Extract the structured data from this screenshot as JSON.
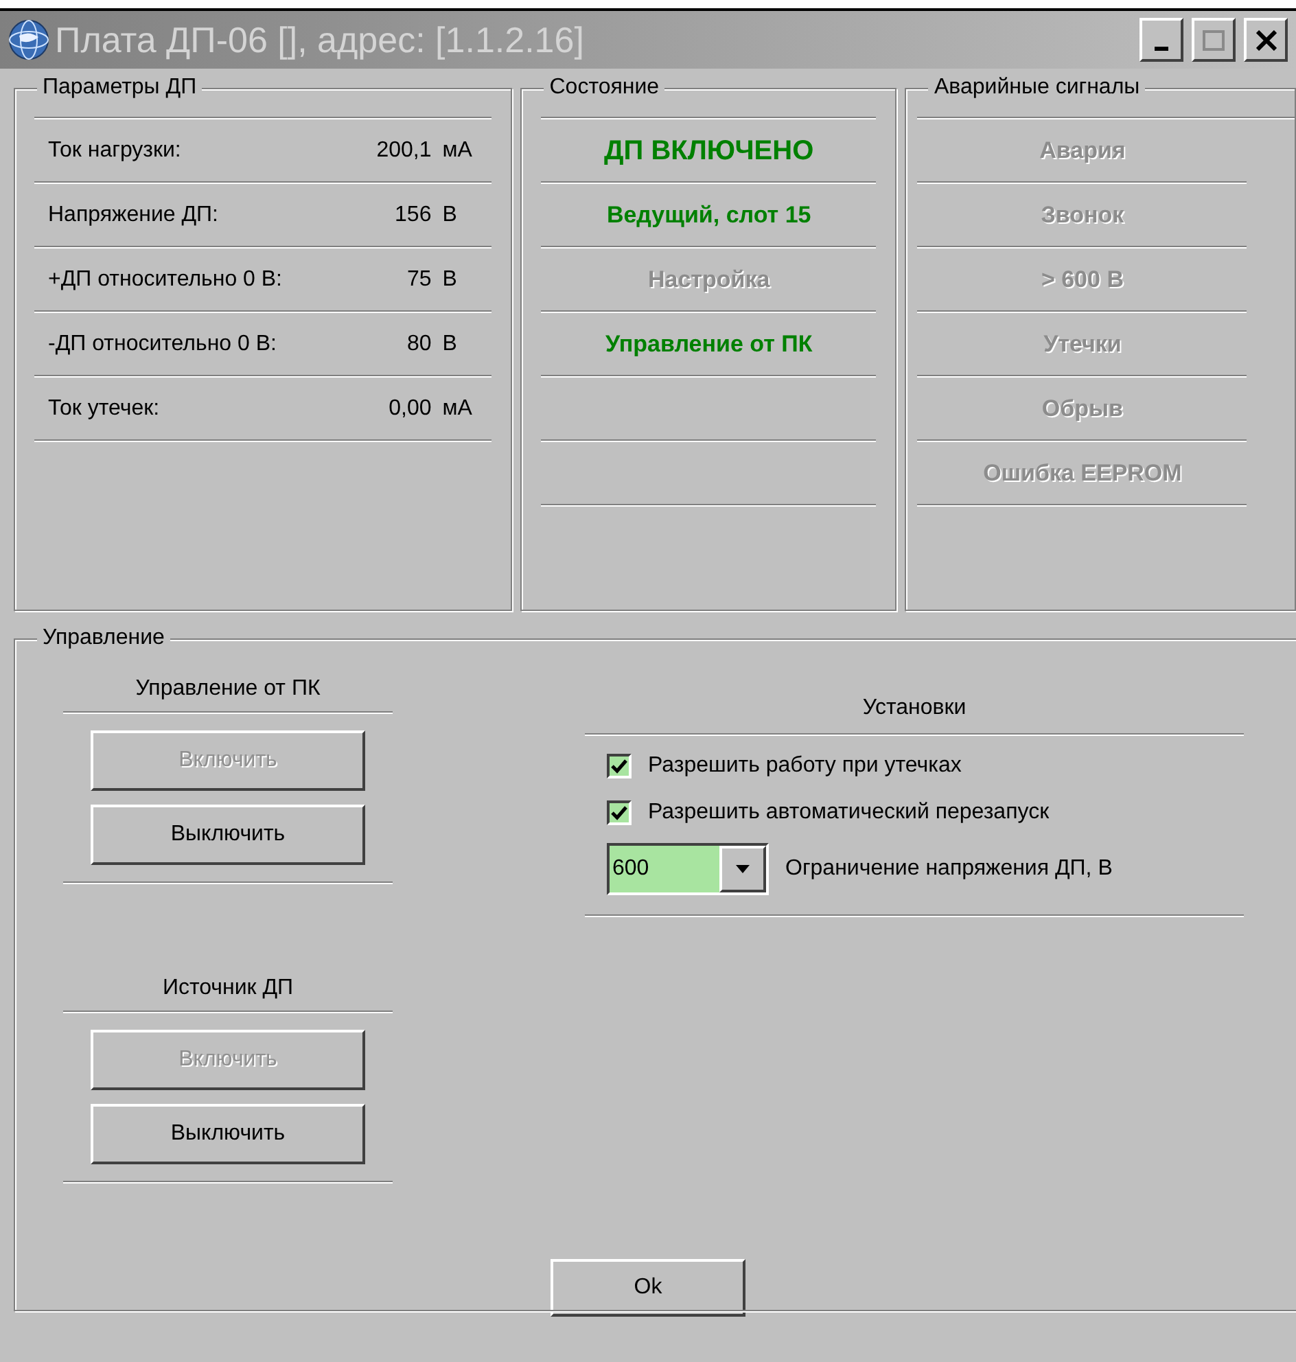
{
  "window": {
    "title": "Плата ДП-06 [], адрес: [1.1.2.16]"
  },
  "parameters": {
    "title": "Параметры ДП",
    "rows": [
      {
        "label": "Ток нагрузки:",
        "value": "200,1",
        "unit": "мА"
      },
      {
        "label": "Напряжение ДП:",
        "value": "156",
        "unit": "В"
      },
      {
        "label": "+ДП относительно 0 В:",
        "value": "75",
        "unit": "В"
      },
      {
        "label": "-ДП относительно 0 В:",
        "value": "80",
        "unit": "В"
      },
      {
        "label": "Ток утечек:",
        "value": "0,00",
        "unit": "мА"
      }
    ]
  },
  "status": {
    "title": "Состояние",
    "items": [
      {
        "text": "ДП ВКЛЮЧЕНО",
        "active": true
      },
      {
        "text": "Ведущий, слот 15",
        "active": true
      },
      {
        "text": "Настройка",
        "active": false
      },
      {
        "text": "Управление от ПК",
        "active": true
      }
    ]
  },
  "alarms": {
    "title": "Аварийные сигналы",
    "items": [
      {
        "text": "Авария",
        "active": false
      },
      {
        "text": "Звонок",
        "active": false
      },
      {
        "text": "> 600 В",
        "active": false
      },
      {
        "text": "Утечки",
        "active": false
      },
      {
        "text": "Обрыв",
        "active": false
      },
      {
        "text": "Ошибка EEPROM",
        "active": false
      }
    ]
  },
  "control": {
    "title": "Управление",
    "sections": [
      {
        "title": "Управление от ПК",
        "buttons": [
          {
            "label": "Включить",
            "disabled": true
          },
          {
            "label": "Выключить",
            "disabled": false
          }
        ]
      },
      {
        "title": "Источник ДП",
        "buttons": [
          {
            "label": "Включить",
            "disabled": true
          },
          {
            "label": "Выключить",
            "disabled": false
          }
        ]
      }
    ],
    "settings": {
      "title": "Установки",
      "checkboxes": [
        {
          "label": "Разрешить работу при утечках",
          "checked": true
        },
        {
          "label": "Разрешить автоматический перезапуск",
          "checked": true
        }
      ],
      "combo": {
        "value": "600",
        "label": "Ограничение напряжения ДП, В"
      }
    }
  },
  "ok_button": "Ok"
}
